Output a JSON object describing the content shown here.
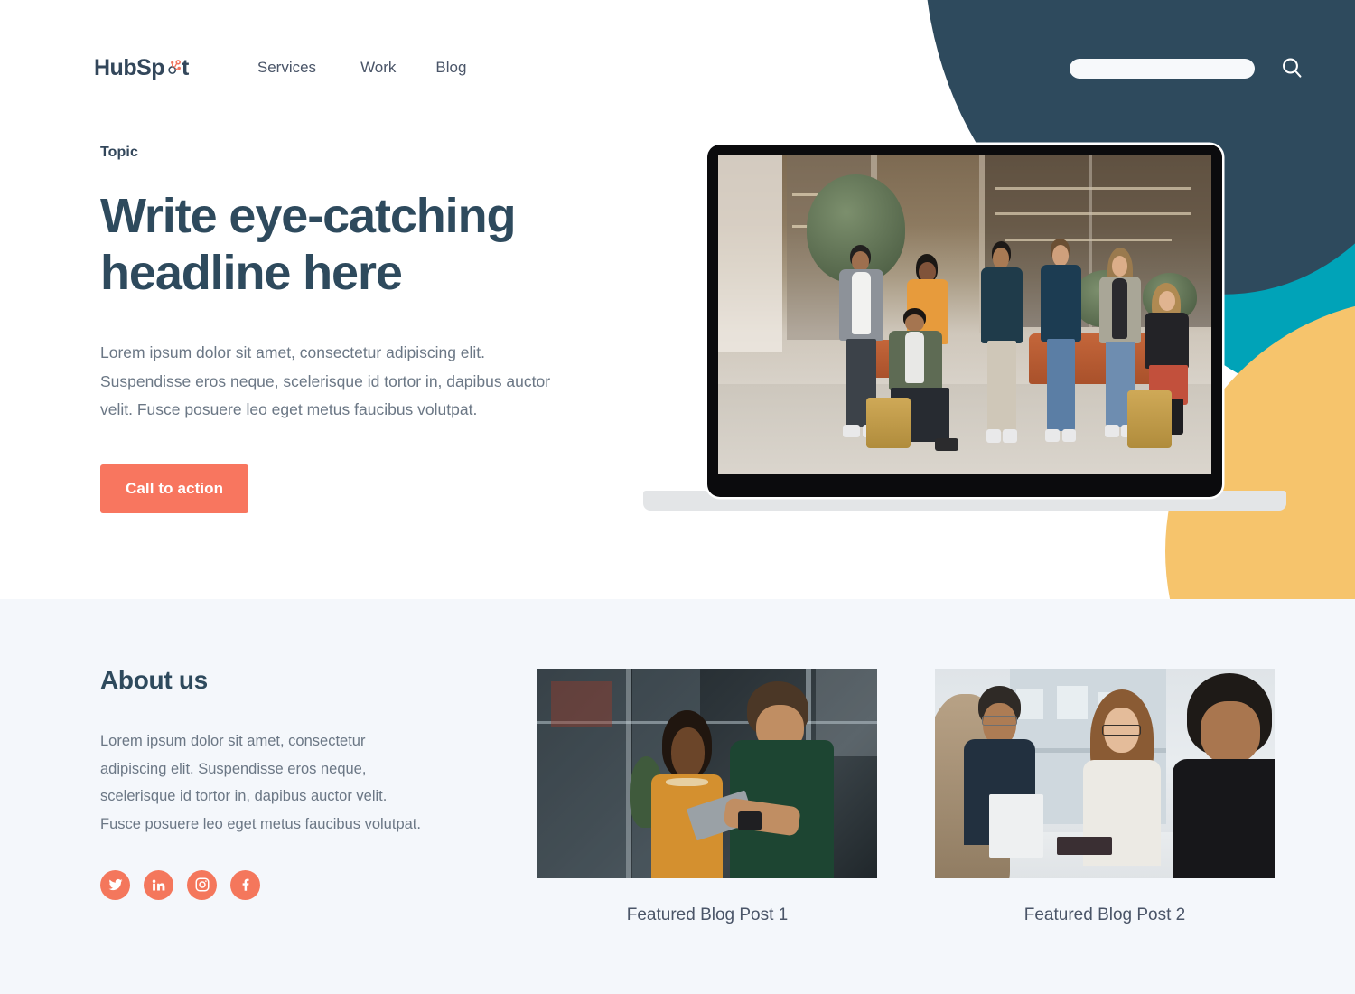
{
  "brand": {
    "logo_text_1": "HubSp",
    "logo_text_2": "t",
    "logo_name": "HubSpot"
  },
  "colors": {
    "navy": "#2E4A5D",
    "teal": "#00A3B8",
    "yellow": "#F6C46C",
    "coral": "#F8765F",
    "body_text": "#6B7785",
    "section_bg": "#F4F7FB"
  },
  "nav": {
    "items": [
      {
        "label": "Services"
      },
      {
        "label": "Work"
      },
      {
        "label": "Blog"
      }
    ]
  },
  "search": {
    "value": "",
    "placeholder": "",
    "icon": "search-icon"
  },
  "hero": {
    "topic": "Topic",
    "headline_line_1": "Write eye-catching",
    "headline_line_2": "headline here",
    "body": "Lorem ipsum dolor sit amet, consectetur adipiscing elit. Suspendisse eros neque, scelerisque id tortor in, dapibus auctor velit. Fusce posuere leo eget metus faucibus volutpat.",
    "cta_label": "Call to action",
    "device_image_alt": "team-group-photo"
  },
  "about": {
    "title": "About us",
    "body": "Lorem ipsum dolor sit amet, consectetur adipiscing elit. Suspendisse eros neque, scelerisque id tortor in, dapibus auctor velit. Fusce posuere leo eget metus faucibus volutpat.",
    "socials": [
      {
        "name": "twitter-icon",
        "label": "Twitter"
      },
      {
        "name": "linkedin-icon",
        "label": "LinkedIn"
      },
      {
        "name": "instagram-icon",
        "label": "Instagram"
      },
      {
        "name": "facebook-icon",
        "label": "Facebook"
      }
    ]
  },
  "blog": {
    "posts": [
      {
        "caption": "Featured Blog Post 1",
        "image_alt": "two-colleagues-with-tablet"
      },
      {
        "caption": "Featured Blog Post 2",
        "image_alt": "meeting-around-table"
      }
    ]
  }
}
